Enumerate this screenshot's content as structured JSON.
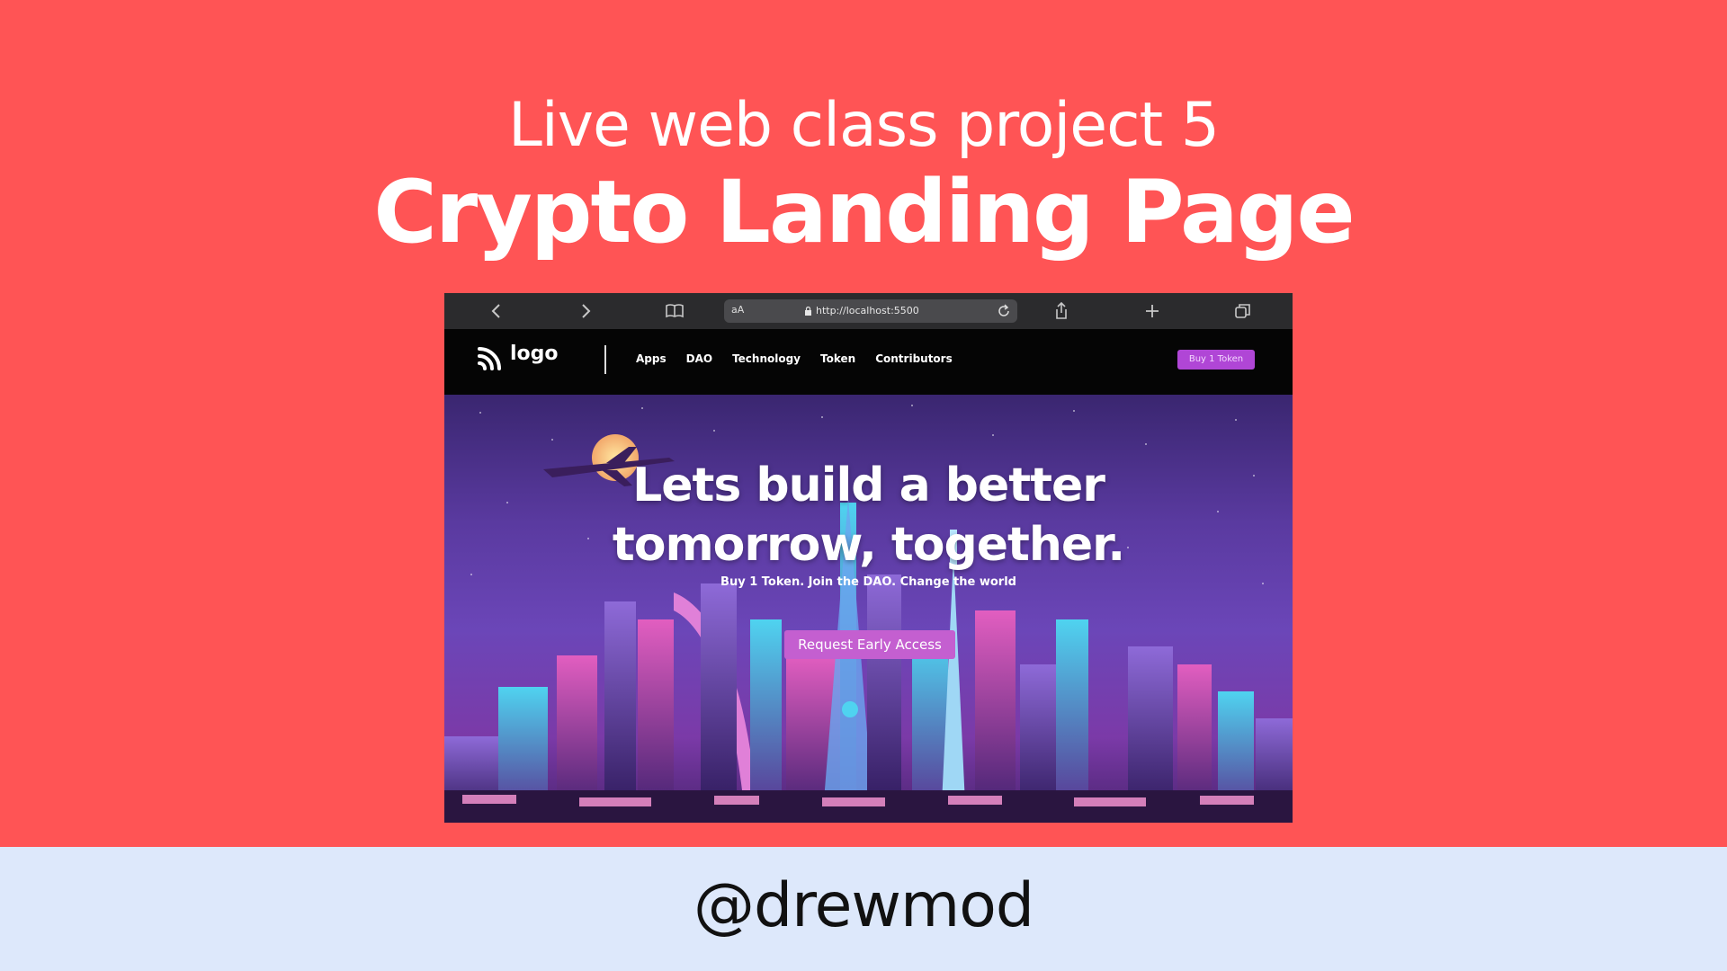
{
  "slide": {
    "subtitle": "Live web class project 5",
    "title": "Crypto Landing Page",
    "handle": "@drewmod",
    "colors": {
      "background": "#ff5455",
      "footer": "#dde8fb"
    }
  },
  "browser": {
    "text_size_label": "aA",
    "url": "http://localhost:5500",
    "icons": [
      "back-icon",
      "forward-icon",
      "book-icon",
      "lock-icon",
      "reload-icon",
      "share-icon",
      "plus-icon",
      "tabs-icon"
    ]
  },
  "site": {
    "logo_text": "logo",
    "nav": [
      "Apps",
      "DAO",
      "Technology",
      "Token",
      "Contributors"
    ],
    "buy_button": "Buy 1 Token",
    "hero": {
      "headline_line1": "Lets build a better",
      "headline_line2": "tomorrow, together.",
      "subline": "Buy 1 Token. Join the DAO. Change the world",
      "cta": "Request Early Access"
    },
    "colors": {
      "accent": "#b046d6",
      "cta": "#c45fd0",
      "nav_bg": "#050505"
    }
  }
}
